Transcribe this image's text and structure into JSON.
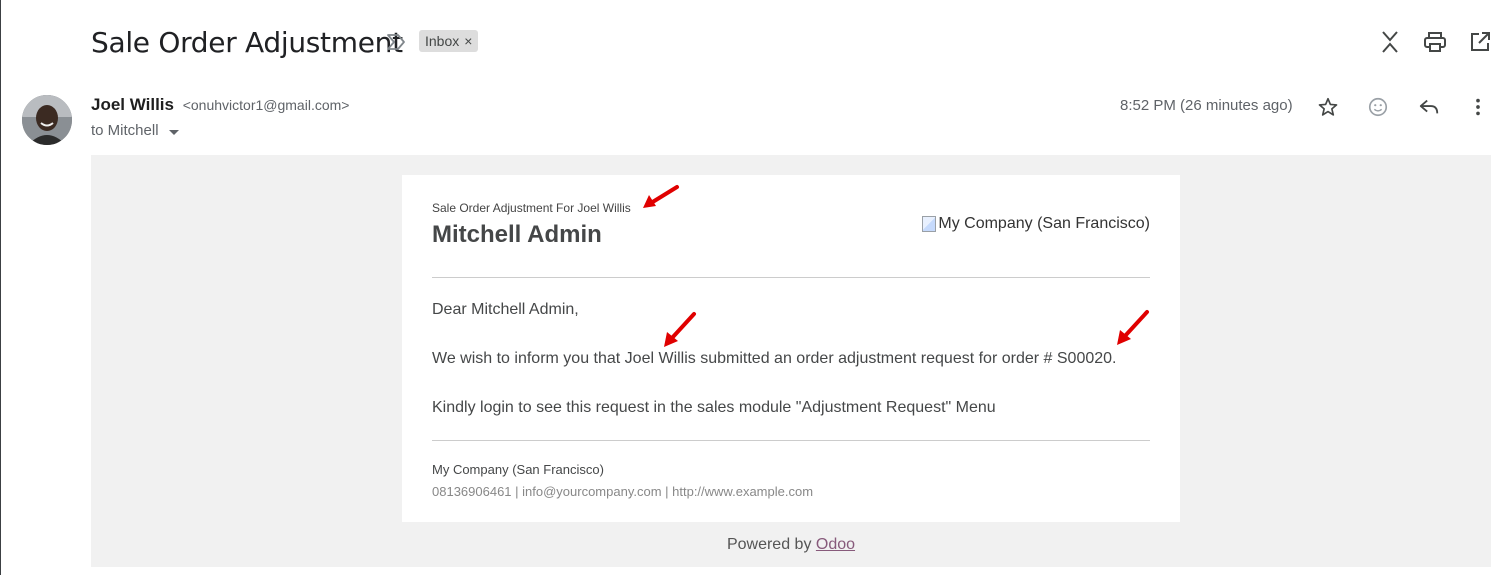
{
  "subject": "Sale Order Adjustment",
  "label_chip": {
    "text": "Inbox",
    "remove": "×"
  },
  "sender": {
    "name": "Joel Willis",
    "email": "<onuhvictor1@gmail.com>"
  },
  "recipient": "to Mitchell",
  "time": "8:52 PM (26 minutes ago)",
  "icons": {
    "toolbar": [
      "collapse-all-icon",
      "print-icon",
      "open-in-new-window-icon"
    ],
    "actions": [
      "star-icon",
      "emoji-reaction-icon",
      "reply-icon",
      "more-vert-icon"
    ],
    "importance": "importance-marker-icon"
  },
  "card": {
    "pretitle": "Sale Order Adjustment For Joel Willis",
    "title": "Mitchell Admin",
    "logo_alt": "My Company (San Francisco)",
    "greeting": "Dear Mitchell Admin,",
    "message": "We wish to inform you that Joel Willis submitted an order adjustment request for order # S00020.",
    "instruction": "Kindly login to see this request in the sales module \"Adjustment Request\" Menu",
    "footer_company": "My Company (San Francisco)",
    "footer_contact": "08136906461 | info@yourcompany.com | http://www.example.com"
  },
  "powered": {
    "prefix": "Powered by ",
    "link": "Odoo"
  },
  "colors": {
    "annotation_arrow": "#e00000",
    "odoo_link": "#875a7b",
    "body_bg": "#f1f1f1"
  }
}
